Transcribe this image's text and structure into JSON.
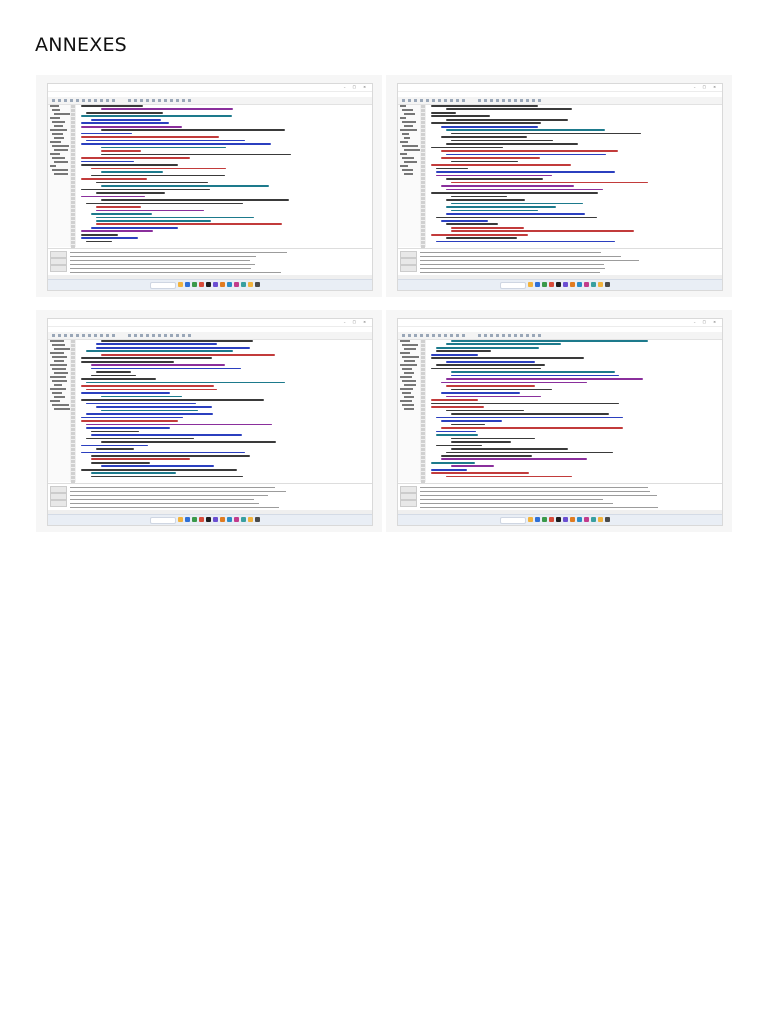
{
  "page": {
    "heading": "ANNEXES"
  },
  "figures": [
    {
      "id": "screenshot-1"
    },
    {
      "id": "screenshot-2"
    },
    {
      "id": "screenshot-3"
    },
    {
      "id": "screenshot-4"
    }
  ],
  "colors": {
    "background": "#ffffff",
    "figure_frame": "#f6f6f6",
    "code_blue": "#2b3fbf",
    "code_purple": "#8a2f9c",
    "taskbar": "#e9eef5"
  }
}
